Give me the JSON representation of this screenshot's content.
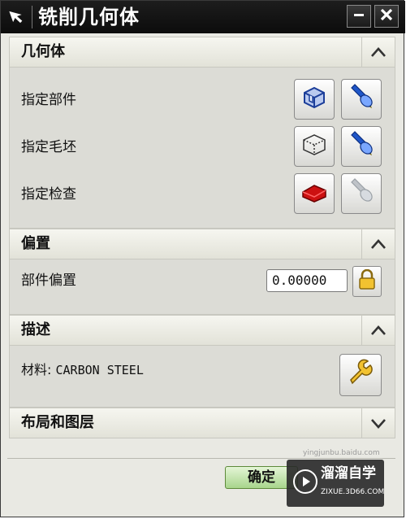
{
  "window": {
    "title": "铣削几何体",
    "icon": "pointer-arrow-icon",
    "minimize_icon": "minimize-icon",
    "close_icon": "close-icon"
  },
  "sections": {
    "geometry": {
      "header": "几何体",
      "collapse_icon": "chevron-up-icon",
      "rows": [
        {
          "label": "指定部件",
          "select_icon": "part-select-icon",
          "display_icon": "flashlight-icon"
        },
        {
          "label": "指定毛坯",
          "select_icon": "blank-wireframe-icon",
          "display_icon": "flashlight-icon"
        },
        {
          "label": "指定检查",
          "select_icon": "check-red-icon",
          "display_icon": "flashlight-disabled-icon"
        }
      ]
    },
    "offset": {
      "header": "偏置",
      "collapse_icon": "chevron-up-icon",
      "label": "部件偏置",
      "value": "0.00000",
      "lock_icon": "lock-icon"
    },
    "description": {
      "header": "描述",
      "collapse_icon": "chevron-up-icon",
      "material_label": "材料:",
      "material_value": "CARBON STEEL",
      "edit_icon": "wrench-icon"
    },
    "layout": {
      "header": "布局和图层",
      "expand_icon": "chevron-down-icon"
    }
  },
  "buttons": {
    "ok": "确定"
  },
  "watermark": {
    "brand": "溜溜自学",
    "url_small": "ZIXUE.3D66.COM",
    "url": "yingjunbu.baidu.com"
  },
  "colors": {
    "titlebar": "#111111",
    "ok_button": "#a8d58c",
    "flashlight": "#1f56c8",
    "check_red": "#cc1111"
  }
}
